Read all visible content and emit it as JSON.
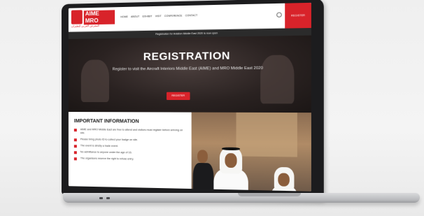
{
  "site": {
    "logo_text": "AIME MRO",
    "logo_subtitle": "المعرض العربي للطيران",
    "nav": [
      "HOME",
      "ABOUT",
      "EXHIBIT",
      "VISIT",
      "CONFERENCE",
      "CONTACT"
    ],
    "header_button": "REGISTER",
    "announcement": "Registration for Aviation Middle East 2020 is now open"
  },
  "hero": {
    "title": "REGISTRATION",
    "subtitle": "Register to visit the Aircraft Interiors Middle East (AIME) and MRO Middle East 2020",
    "button": "REGISTER"
  },
  "info": {
    "title": "IMPORTANT INFORMATION",
    "items": [
      "AIME and MRO Middle East are free to attend and visitors must register before arriving on site.",
      "Please bring photo ID to collect your badge on site.",
      "The event is strictly a trade event.",
      "No admittance to anyone under the age of 16.",
      "The organisers reserve the right to refuse entry."
    ]
  },
  "colors": {
    "brand_red": "#d8232a",
    "hero_dark": "#2a2221",
    "laptop_bezel": "#1c1c1e"
  }
}
